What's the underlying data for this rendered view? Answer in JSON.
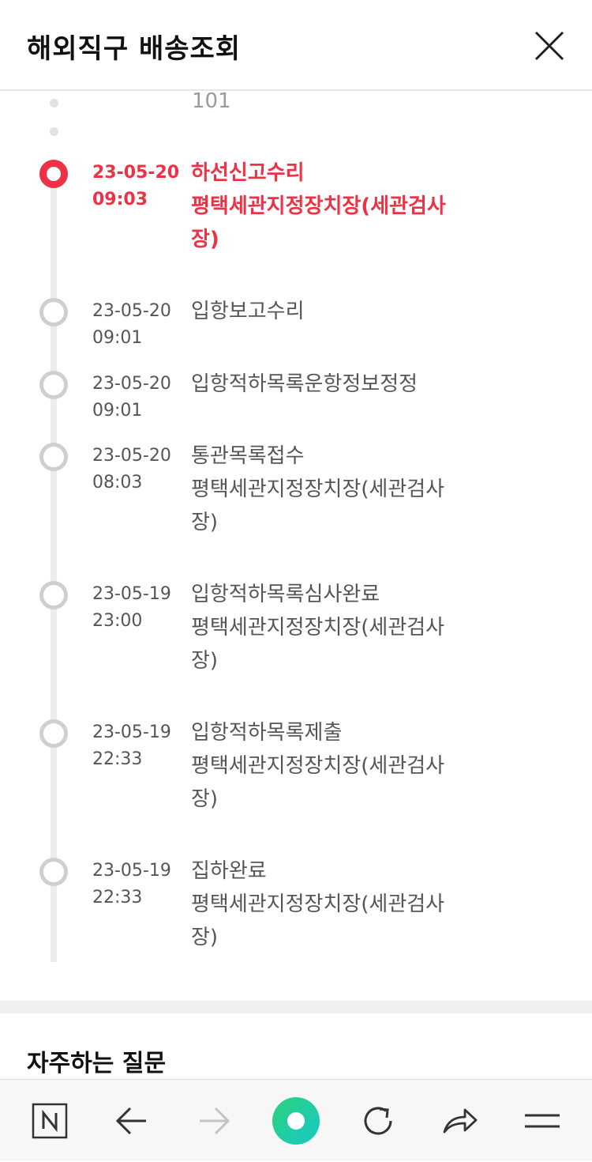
{
  "header": {
    "title": "해외직구 배송조회",
    "close_icon": "close-icon"
  },
  "timeline": {
    "partial_top_text": "101",
    "events": [
      {
        "date": "23-05-20",
        "time": "09:03",
        "status": "하선신고수리",
        "location_line1": "평택세관지정장치장(세관검사",
        "location_line2": "장)",
        "active": true
      },
      {
        "date": "23-05-20",
        "time": "09:01",
        "status": "입항보고수리",
        "location_line1": "",
        "location_line2": "",
        "active": false
      },
      {
        "date": "23-05-20",
        "time": "09:01",
        "status": "입항적하목록운항정보정정",
        "location_line1": "",
        "location_line2": "",
        "active": false
      },
      {
        "date": "23-05-20",
        "time": "08:03",
        "status": "통관목록접수",
        "location_line1": "평택세관지정장치장(세관검사",
        "location_line2": "장)",
        "active": false
      },
      {
        "date": "23-05-19",
        "time": "23:00",
        "status": "입항적하목록심사완료",
        "location_line1": "평택세관지정장치장(세관검사",
        "location_line2": "장)",
        "active": false
      },
      {
        "date": "23-05-19",
        "time": "22:33",
        "status": "입항적하목록제출",
        "location_line1": "평택세관지정장치장(세관검사",
        "location_line2": "장)",
        "active": false
      },
      {
        "date": "23-05-19",
        "time": "22:33",
        "status": "집하완료",
        "location_line1": "평택세관지정장치장(세관검사",
        "location_line2": "장)",
        "active": false
      }
    ]
  },
  "faq": {
    "title": "자주하는 질문"
  },
  "bottom_bar": {
    "icons": [
      "naver-n-icon",
      "back-arrow-icon",
      "forward-arrow-icon",
      "green-dot-home-icon",
      "refresh-icon",
      "share-icon",
      "menu-icon"
    ]
  },
  "colors": {
    "accent_red": "#ed3246",
    "inactive_circle": "#cfcfcf",
    "green_start": "#2bd27a",
    "green_end": "#18c8c8"
  }
}
